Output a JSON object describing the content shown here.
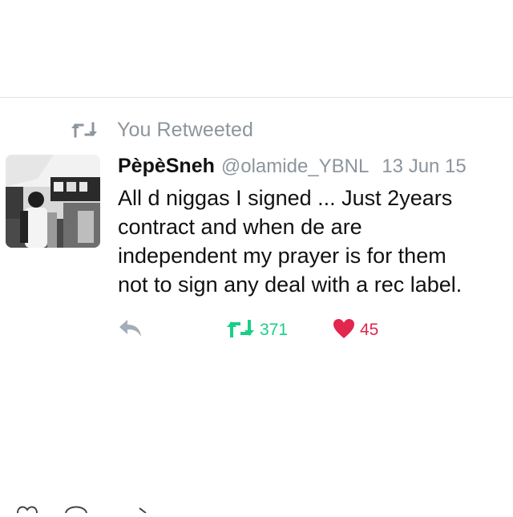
{
  "context": {
    "retweet_label": "You Retweeted",
    "icon": "retweet-icon",
    "color": "#8d959c"
  },
  "tweet": {
    "avatar_icon": "profile-photo",
    "display_name": "PèpèSneh",
    "handle": "@olamide_YBNL",
    "timestamp": "13 Jun 15",
    "text_lines": [
      "All d niggas I signed ... Just 2years",
      "contract and when de are",
      "independent my prayer is for them",
      "not to sign any deal with a rec label."
    ]
  },
  "actions": {
    "reply": {
      "icon": "reply-icon",
      "color": "#a4aeb6"
    },
    "retweet": {
      "icon": "retweet-icon",
      "count": "371",
      "color": "#19cf86"
    },
    "like": {
      "icon": "heart-icon",
      "count": "45",
      "color": "#e2264d"
    }
  },
  "colors": {
    "text": "#111111",
    "secondary": "#8d959c",
    "divider": "#e2e2e2"
  }
}
